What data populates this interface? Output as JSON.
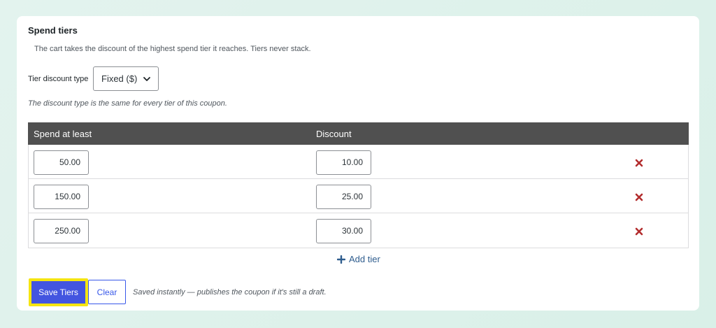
{
  "section": {
    "title": "Spend tiers",
    "description": "The cart takes the discount of the highest spend tier it reaches. Tiers never stack."
  },
  "discount_type": {
    "label": "Tier discount type",
    "selected": "Fixed ($)",
    "note": "The discount type is the same for every tier of this coupon."
  },
  "table": {
    "headers": {
      "spend": "Spend at least",
      "discount": "Discount"
    },
    "rows": [
      {
        "spend": "50.00",
        "discount": "10.00"
      },
      {
        "spend": "150.00",
        "discount": "25.00"
      },
      {
        "spend": "250.00",
        "discount": "30.00"
      }
    ]
  },
  "actions": {
    "add_tier": "Add tier",
    "save": "Save Tiers",
    "clear": "Clear",
    "save_note": "Saved instantly — publishes the coupon if it's still a draft."
  },
  "colors": {
    "header_bg": "#505050",
    "primary_button": "#4355e0",
    "focus_outline": "#f5e510",
    "remove_icon": "#b32d2e",
    "link": "#2f5d8e"
  }
}
